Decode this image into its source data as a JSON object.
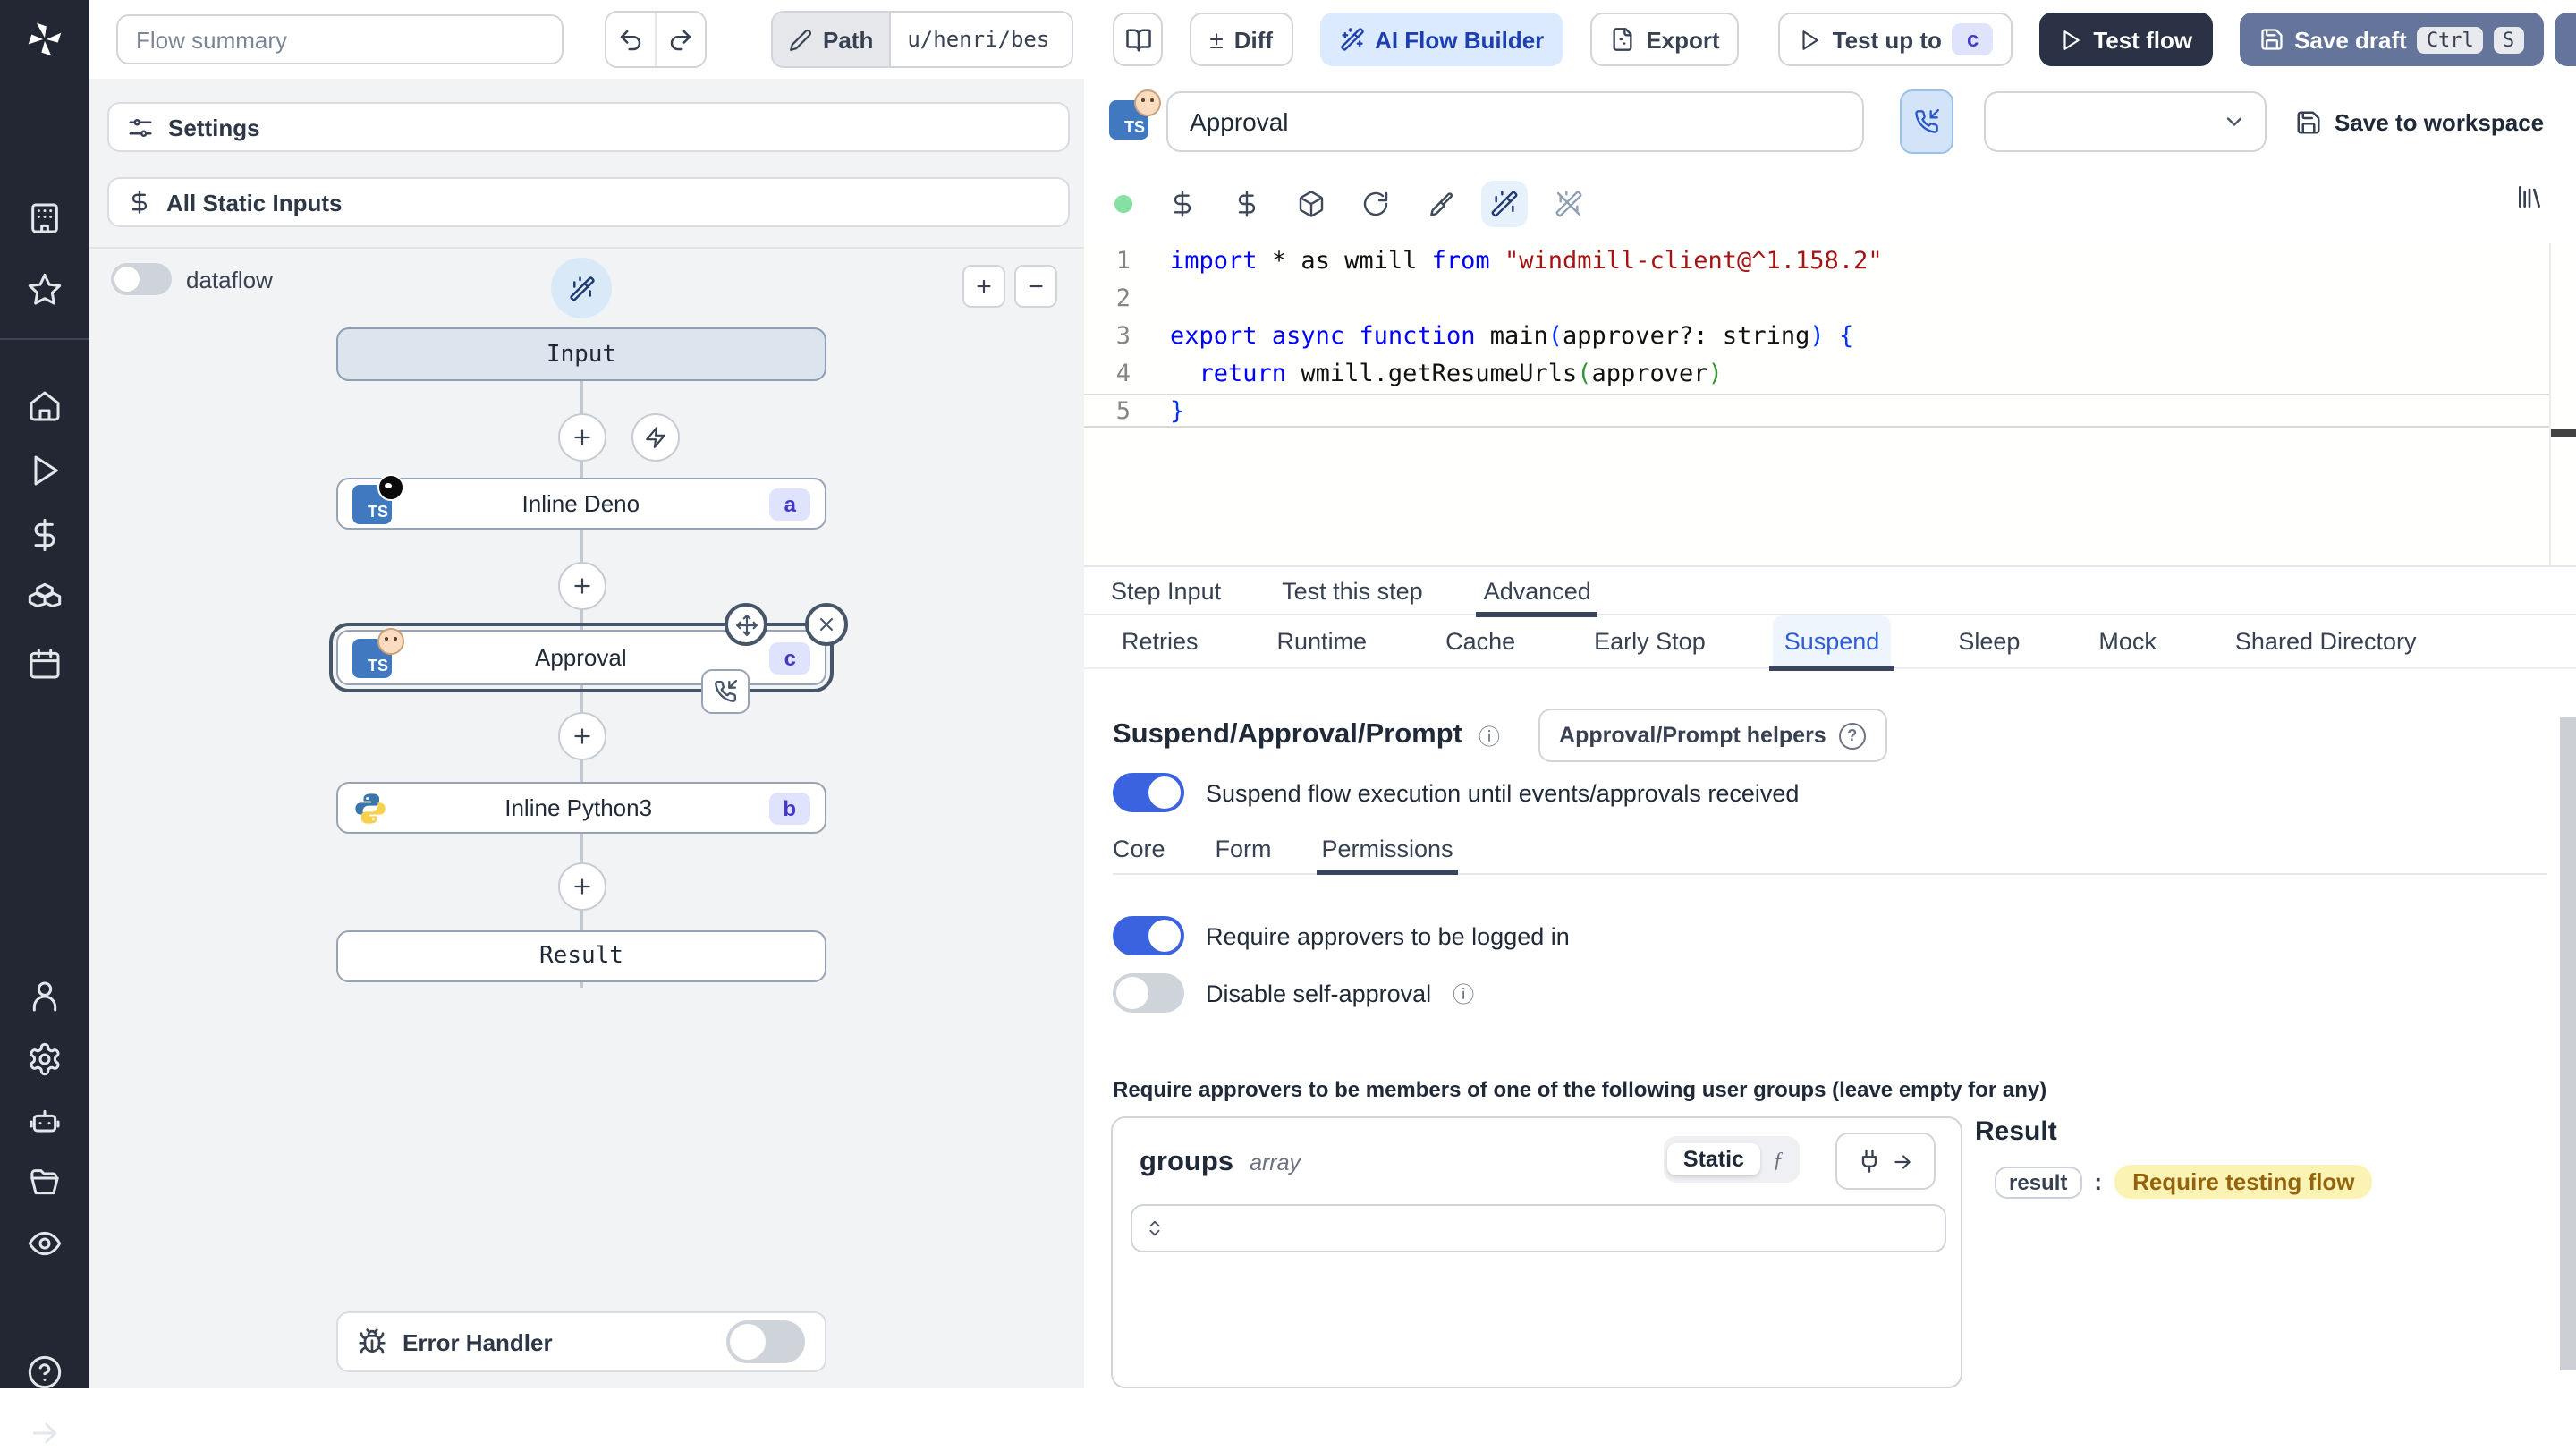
{
  "colors": {
    "accent_blue": "#3b63e0",
    "tab_active_blue": "#2f5cd7",
    "badge_bg": "#dfe3fc",
    "badge_text": "#4338ca",
    "ai_button_bg": "#dbeafe",
    "ai_button_text": "#1e40af",
    "test_flow_bg": "#2b3245",
    "save_draft_bg": "#64749a",
    "sidebar_bg": "#222733",
    "result_value_bg": "#faf3b4",
    "result_value_text": "#92640d",
    "status_dot_green": "#86e0a2"
  },
  "topbar": {
    "flow_summary_placeholder": "Flow summary",
    "path_label": "Path",
    "path_value": "u/henri/bes",
    "diff_label": "Diff",
    "diff_sign": "±",
    "ai_flow_builder_label": "AI Flow Builder",
    "export_label": "Export",
    "test_up_to_label": "Test up to",
    "test_up_to_badge": "c",
    "test_flow_label": "Test flow",
    "save_draft_label": "Save draft",
    "shortcut_mod": "Ctrl",
    "shortcut_key": "S"
  },
  "flow": {
    "settings_label": "Settings",
    "static_inputs_label": "All Static Inputs",
    "dataflow_label": "dataflow",
    "zoom_in": "+",
    "zoom_out": "−",
    "input_node_label": "Input",
    "result_node_label": "Result",
    "steps": [
      {
        "label": "Inline Deno",
        "badge": "a"
      },
      {
        "label": "Approval",
        "badge": "c"
      },
      {
        "label": "Inline Python3",
        "badge": "b"
      }
    ],
    "error_handler_label": "Error Handler"
  },
  "editor": {
    "title_value": "Approval",
    "save_to_workspace_label": "Save to workspace",
    "code": {
      "lines": [
        {
          "n": "1",
          "tokens": [
            {
              "c": "kw",
              "t": "import"
            },
            {
              "c": "pl",
              "t": " * as wmill "
            },
            {
              "c": "kw",
              "t": "from"
            },
            {
              "c": "str",
              "t": " \"windmill-client@^1.158.2\""
            }
          ]
        },
        {
          "n": "2",
          "tokens": []
        },
        {
          "n": "3",
          "tokens": [
            {
              "c": "kw",
              "t": "export"
            },
            {
              "c": "pl",
              "t": " "
            },
            {
              "c": "kw",
              "t": "async"
            },
            {
              "c": "pl",
              "t": " "
            },
            {
              "c": "kw",
              "t": "function"
            },
            {
              "c": "pl",
              "t": " main"
            },
            {
              "c": "b1",
              "t": "("
            },
            {
              "c": "pl",
              "t": "approver?: string"
            },
            {
              "c": "b1",
              "t": ")"
            },
            {
              "c": "pl",
              "t": " "
            },
            {
              "c": "b1",
              "t": "{"
            }
          ]
        },
        {
          "n": "4",
          "tokens": [
            {
              "c": "pl",
              "t": "  "
            },
            {
              "c": "kw",
              "t": "return"
            },
            {
              "c": "pl",
              "t": " wmill.getResumeUrls"
            },
            {
              "c": "b2",
              "t": "("
            },
            {
              "c": "pl",
              "t": "approver"
            },
            {
              "c": "b2",
              "t": ")"
            }
          ]
        },
        {
          "n": "5",
          "tokens": [
            {
              "c": "b1",
              "t": "}"
            }
          ],
          "current": true
        }
      ]
    }
  },
  "tabs": {
    "main": [
      "Step Input",
      "Test this step",
      "Advanced"
    ],
    "advanced": [
      "Retries",
      "Runtime",
      "Cache",
      "Early Stop",
      "Suspend",
      "Sleep",
      "Mock",
      "Shared Directory"
    ]
  },
  "suspend": {
    "heading": "Suspend/Approval/Prompt",
    "helpers_button_label": "Approval/Prompt helpers",
    "suspend_toggle_label": "Suspend flow execution until events/approvals received",
    "subtabs": [
      "Core",
      "Form",
      "Permissions"
    ],
    "require_login_label": "Require approvers to be logged in",
    "disable_self_approval_label": "Disable self-approval",
    "groups_note": "Require approvers to be members of one of the following user groups (leave empty for any)",
    "groups_label": "groups",
    "groups_type": "array",
    "static_label": "Static",
    "fn_glyph": "ƒ",
    "result_heading": "Result",
    "result_key": "result",
    "result_value": "Require testing flow"
  }
}
